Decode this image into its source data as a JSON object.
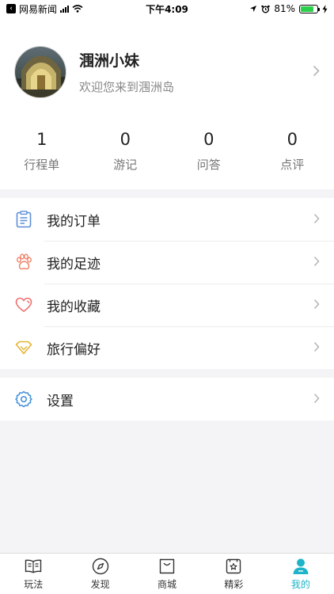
{
  "status_bar": {
    "back_app": "网易新闻",
    "time": "下午4:09",
    "battery": "81%",
    "battery_level": 0.81
  },
  "profile": {
    "name": "涠洲小妹",
    "subtitle": "欢迎您来到涠洲岛"
  },
  "stats": [
    {
      "value": "1",
      "label": "行程单"
    },
    {
      "value": "0",
      "label": "游记"
    },
    {
      "value": "0",
      "label": "问答"
    },
    {
      "value": "0",
      "label": "点评"
    }
  ],
  "menu": [
    {
      "label": "我的订单",
      "icon": "clipboard-icon",
      "color": "#5b8fd6"
    },
    {
      "label": "我的足迹",
      "icon": "paw-icon",
      "color": "#ee7f63"
    },
    {
      "label": "我的收藏",
      "icon": "heart-icon",
      "color": "#ee6f6f"
    },
    {
      "label": "旅行偏好",
      "icon": "diamond-icon",
      "color": "#e5b535"
    }
  ],
  "settings": {
    "label": "设置",
    "icon": "gear-icon",
    "color": "#3f8fd8"
  },
  "tabs": [
    {
      "label": "玩法",
      "icon": "book-icon"
    },
    {
      "label": "发现",
      "icon": "compass-icon"
    },
    {
      "label": "商城",
      "icon": "bag-icon"
    },
    {
      "label": "精彩",
      "icon": "star-card-icon"
    },
    {
      "label": "我的",
      "icon": "person-icon",
      "active": true
    }
  ],
  "colors": {
    "accent": "#1db3c9",
    "background": "#f4f4f6"
  }
}
